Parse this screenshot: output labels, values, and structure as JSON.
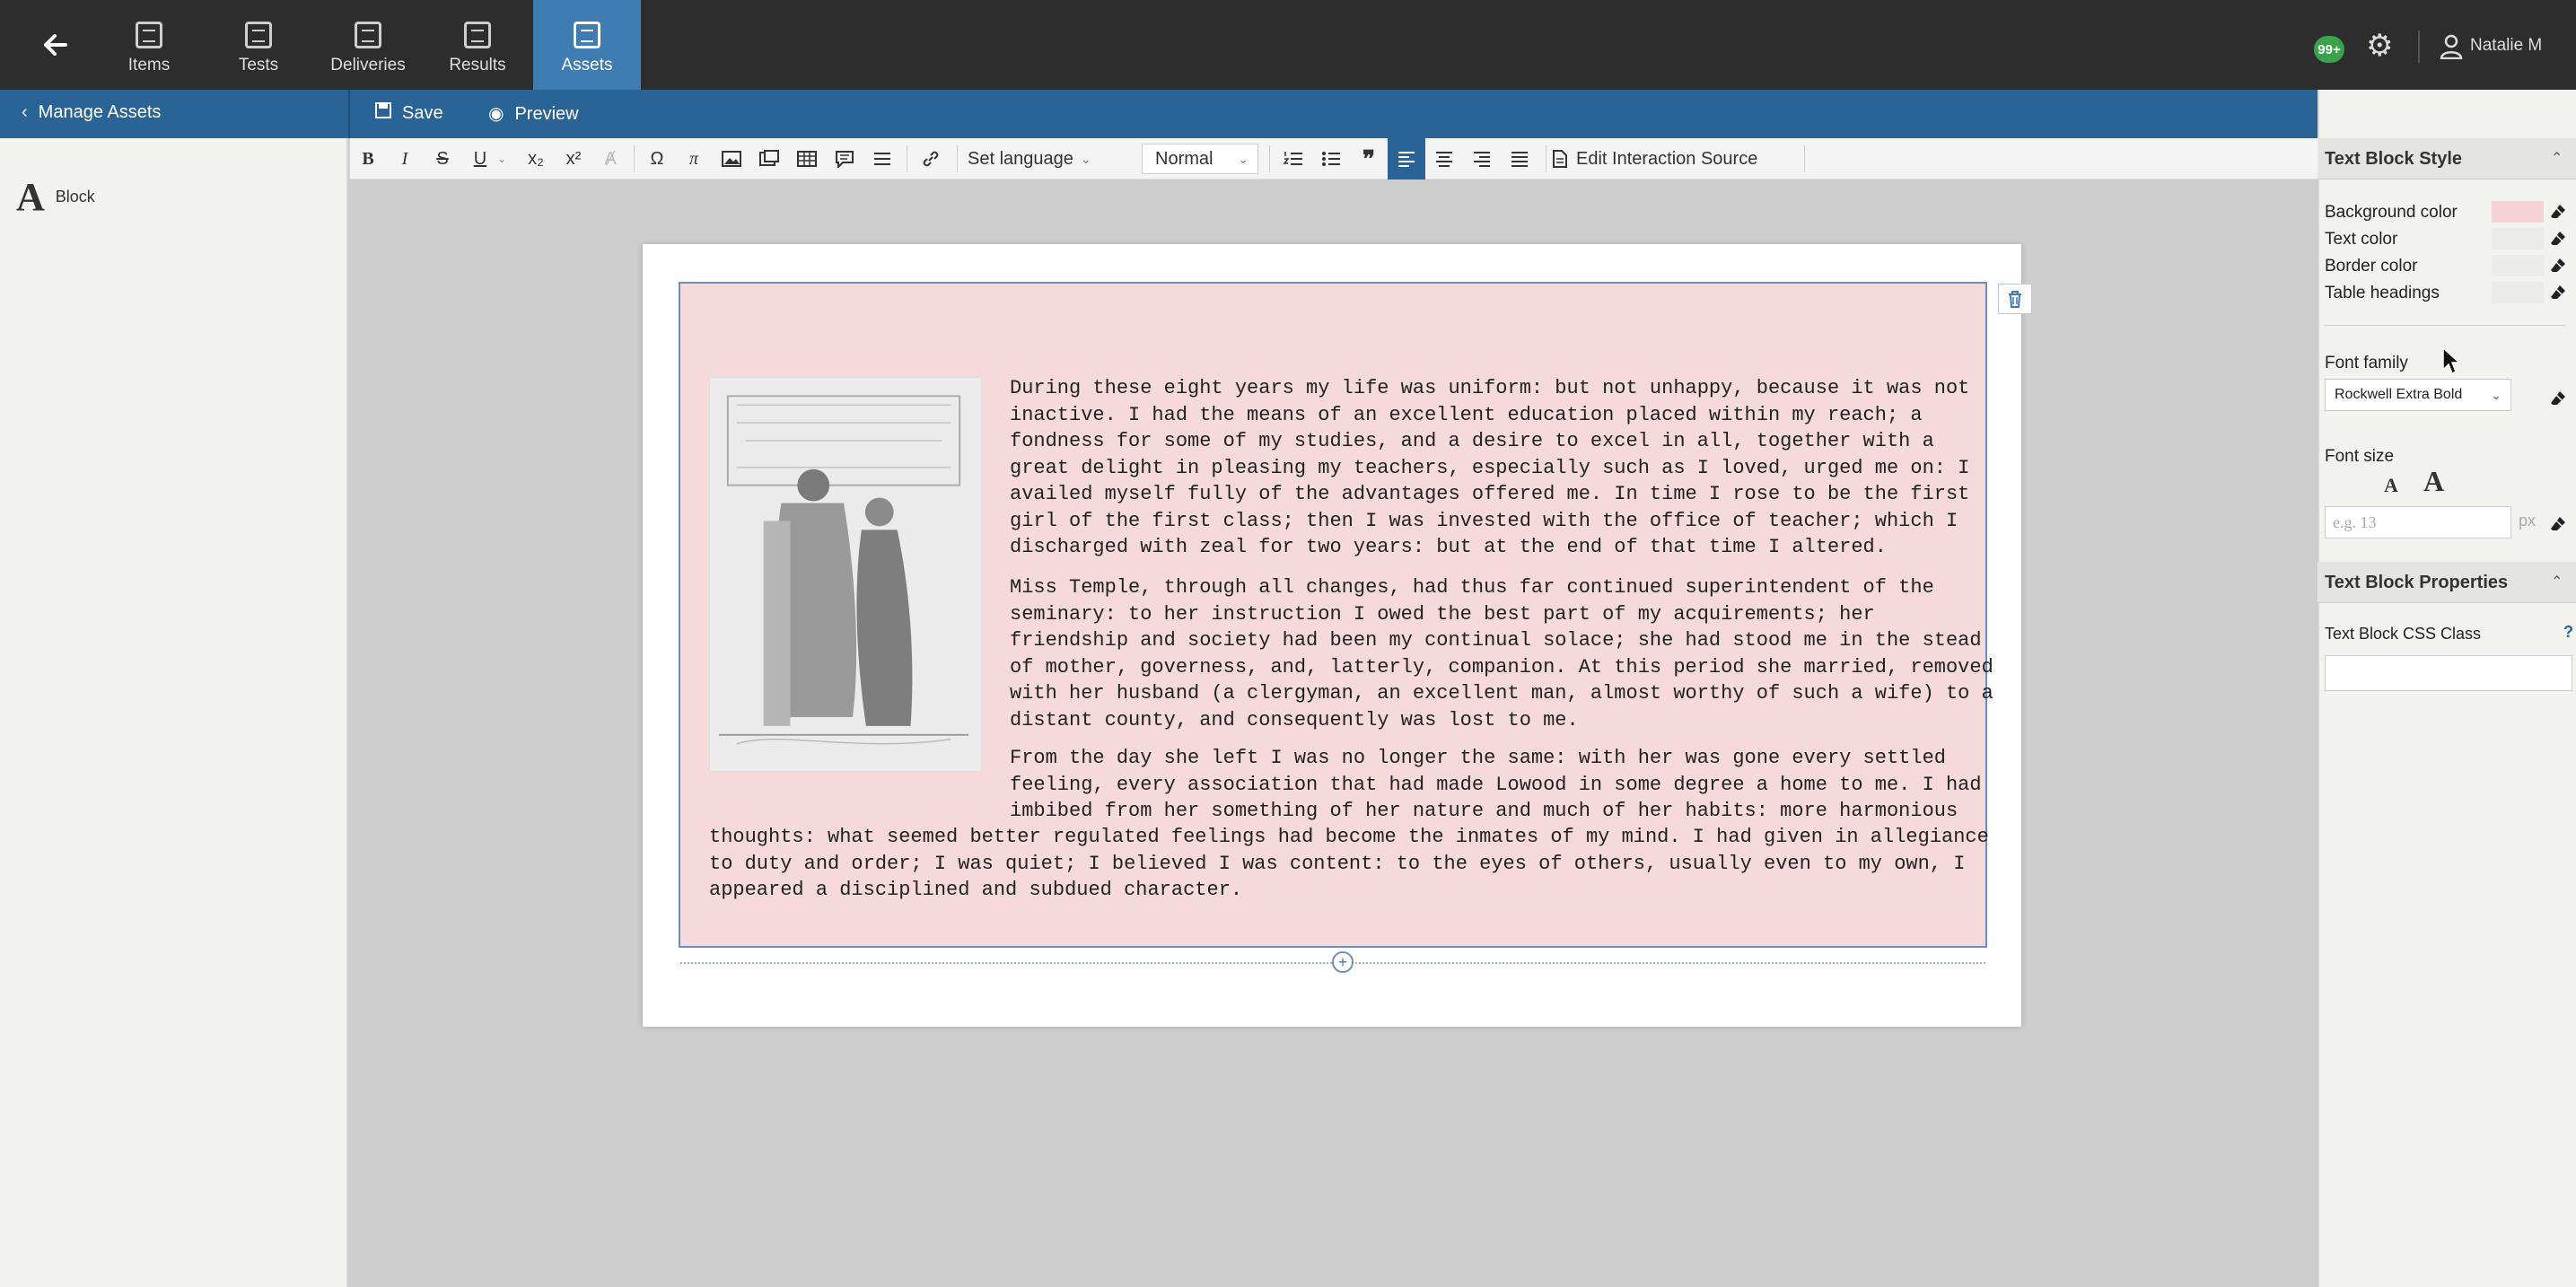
{
  "nav": {
    "tabs": [
      {
        "label": "Items",
        "icon": "items-icon"
      },
      {
        "label": "Tests",
        "icon": "tests-icon"
      },
      {
        "label": "Deliveries",
        "icon": "deliveries-icon"
      },
      {
        "label": "Results",
        "icon": "results-icon"
      },
      {
        "label": "Assets",
        "icon": "assets-icon",
        "active": true
      }
    ],
    "notifications": "99+",
    "user_name": "Natalie M"
  },
  "actionbar": {
    "manage_assets": "Manage Assets",
    "save": "Save",
    "preview": "Preview"
  },
  "left_panel": {
    "block_glyph": "A",
    "block_label": "Block"
  },
  "toolbar": {
    "bold": "B",
    "italic": "I",
    "strike": "S",
    "underline": "U",
    "subscript": "x₂",
    "superscript": "x²",
    "omega": "Ω",
    "pi": "π",
    "set_language": "Set language",
    "paragraph_format": "Normal",
    "edit_source": "Edit Interaction Source"
  },
  "content": {
    "lines": [
      "During these eight years my life was uniform: but not unhappy, because it was not",
      "inactive. I had the means of an excellent education placed within my reach; a",
      "fondness for some of my studies, and a desire to excel in all, together with a",
      "great delight in pleasing my teachers, especially such as I loved, urged me on: I",
      "availed myself fully of the advantages offered me. In time I rose to be the first",
      "girl of the first class; then I was invested with the office of teacher; which I",
      "discharged with zeal for two years: but at the end of that time I altered.",
      "Miss Temple, through all changes, had thus far continued superintendent of the",
      "seminary: to her instruction I owed the best part of my acquirements; her",
      "friendship and society had been my continual solace; she had stood me in the stead",
      "of mother, governess, and, latterly, companion. At this period she married, removed",
      "with her husband (a clergyman, an excellent man, almost worthy of such a wife) to a",
      "distant county, and consequently was lost to me.",
      "From the day she left I was no longer the same: with her was gone every settled",
      "feeling, every association that had made Lowood in some degree a home to me. I had",
      "imbibed from her something of her nature and much of her habits: more harmonious",
      "thoughts: what seemed better regulated feelings had become the inmates of my mind. I had given in allegiance",
      "to duty and order; I was quiet; I believed I was content: to the eyes of others, usually even to my own, I",
      "appeared a disciplined and subdued character."
    ]
  },
  "style_panel": {
    "title": "Text Block Style",
    "background_color_label": "Background color",
    "text_color_label": "Text color",
    "border_color_label": "Border color",
    "table_headings_label": "Table headings",
    "background_color": "#f5d3d5",
    "font_family_label": "Font family",
    "font_family_value": "Rockwell Extra Bold",
    "font_size_label": "Font size",
    "font_size_placeholder": "e.g. 13",
    "font_size_unit": "px",
    "size_small": "A",
    "size_big": "A"
  },
  "properties_panel": {
    "title": "Text Block Properties",
    "css_class_label": "Text Block CSS Class",
    "help": "?"
  },
  "colors": {
    "topnav": "#2d2d2d",
    "accent": "#3e7cb1",
    "actionbar": "#2a6496",
    "block_background": "#f5d9db"
  }
}
